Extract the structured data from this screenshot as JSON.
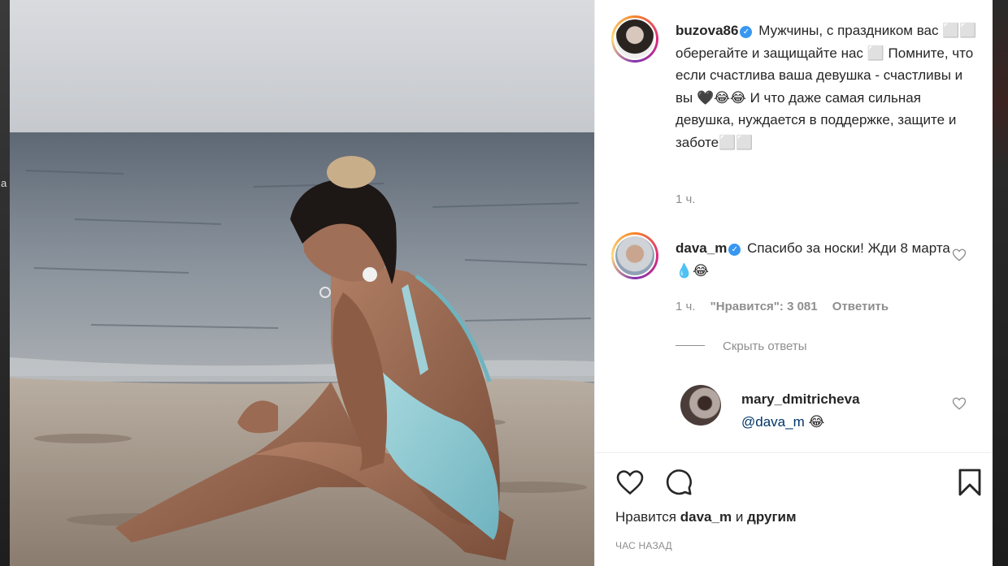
{
  "post": {
    "author": "buzova86",
    "caption_text": "Мужчины, с праздником вас ⬜⬜ оберегайте и защищайте нас ⬜ Помните, что если счастлива ваша девушка - счастливы и вы 🖤😂😂 И что даже самая сильная девушка, нуждается в поддержке, защите и заботе⬜⬜",
    "caption_time": "1 ч."
  },
  "comment": {
    "author": "dava_m",
    "text": "Спасибо за носки! Жди 8 марта 💧😂",
    "time": "1 ч.",
    "likes_label": "\"Нравится\": 3 081",
    "reply_label": "Ответить",
    "hide_replies_label": "Скрыть ответы"
  },
  "reply": {
    "author": "mary_dmitricheva",
    "mention": "@dava_m",
    "emoji": "😂"
  },
  "footer": {
    "likes_prefix": "Нравится",
    "likes_user": "dava_m",
    "likes_middle": "и",
    "likes_suffix": "другим",
    "timestamp": "ЧАС НАЗАД"
  },
  "icons": {
    "like": "heart-icon",
    "comment": "comment-icon",
    "save": "bookmark-icon",
    "verified": "verified-badge-icon"
  },
  "colors": {
    "verified_blue": "#3897f0",
    "text": "#262626",
    "secondary_text": "#8e8e8e"
  }
}
